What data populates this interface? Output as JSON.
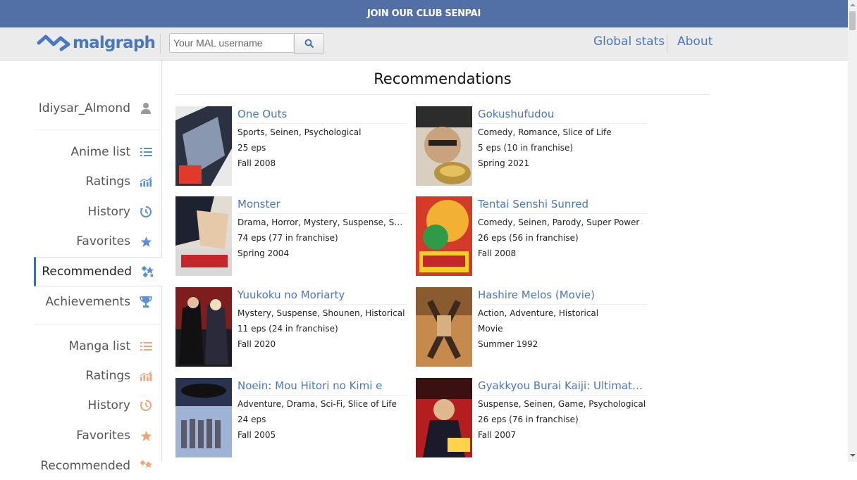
{
  "banner": {
    "text": "JOIN OUR CLUB SENPAI"
  },
  "header": {
    "logo_text": "malgraph",
    "search_placeholder": "Your MAL username",
    "nav": [
      {
        "label": "Global stats"
      },
      {
        "label": "About"
      }
    ]
  },
  "sidebar": {
    "username": "Idiysar_Almond",
    "anime_items": [
      {
        "label": "Anime list",
        "icon": "list-icon"
      },
      {
        "label": "Ratings",
        "icon": "chart-icon"
      },
      {
        "label": "History",
        "icon": "history-icon"
      },
      {
        "label": "Favorites",
        "icon": "star-icon"
      },
      {
        "label": "Recommended",
        "icon": "recommended-icon",
        "active": true
      },
      {
        "label": "Achievements",
        "icon": "trophy-icon"
      }
    ],
    "manga_items": [
      {
        "label": "Manga list",
        "icon": "list-icon"
      },
      {
        "label": "Ratings",
        "icon": "chart-icon"
      },
      {
        "label": "History",
        "icon": "history-icon"
      },
      {
        "label": "Favorites",
        "icon": "star-icon"
      },
      {
        "label": "Recommended",
        "icon": "recommended-icon"
      }
    ],
    "colors": {
      "anime_icon": "#5b8fd6",
      "manga_icon": "#f0a478",
      "active_border": "#3d6bb3"
    }
  },
  "main": {
    "title": "Recommendations",
    "items": [
      {
        "title": "One Outs",
        "genres": "Sports, Seinen, Psychological",
        "episodes": "25 eps",
        "season": "Fall 2008",
        "cover_colors": [
          "#e8e8e8",
          "#2b3140"
        ]
      },
      {
        "title": "Gokushufudou",
        "genres": "Comedy, Romance, Slice of Life",
        "episodes": "5 eps (10 in franchise)",
        "season": "Spring 2021",
        "cover_colors": [
          "#3a3a3a",
          "#c9b48a"
        ]
      },
      {
        "title": "Monster",
        "genres": "Drama, Horror, Mystery, Suspense, Seinen",
        "episodes": "74 eps (77 in franchise)",
        "season": "Spring 2004",
        "cover_colors": [
          "#d9d2c8",
          "#1e2230"
        ]
      },
      {
        "title": "Tentai Senshi Sunred",
        "genres": "Comedy, Seinen, Parody, Super Power",
        "episodes": "26 eps (56 in franchise)",
        "season": "Fall 2008",
        "cover_colors": [
          "#d43a2a",
          "#f2b132"
        ]
      },
      {
        "title": "Yuukoku no Moriarty",
        "genres": "Mystery, Suspense, Shounen, Historical",
        "episodes": "11 eps (24 in franchise)",
        "season": "Fall 2020",
        "cover_colors": [
          "#7d1d1d",
          "#1d1a22"
        ]
      },
      {
        "title": "Hashire Melos (Movie)",
        "genres": "Action, Adventure, Historical",
        "episodes": "Movie",
        "season": "Summer 1992",
        "cover_colors": [
          "#c58a4c",
          "#3b2a1d"
        ]
      },
      {
        "title": "Noein: Mou Hitori no Kimi e",
        "genres": "Adventure, Drama, Sci-Fi, Slice of Life",
        "episodes": "24 eps",
        "season": "Fall 2005",
        "cover_colors": [
          "#9fb3d6",
          "#2a3350"
        ]
      },
      {
        "title": "Gyakkyou Burai Kaiji: Ultimate Survivor",
        "genres": "Suspense, Seinen, Game, Psychological",
        "episodes": "26 eps (76 in franchise)",
        "season": "Fall 2007",
        "cover_colors": [
          "#b51e1e",
          "#1a1a2a"
        ]
      }
    ]
  }
}
